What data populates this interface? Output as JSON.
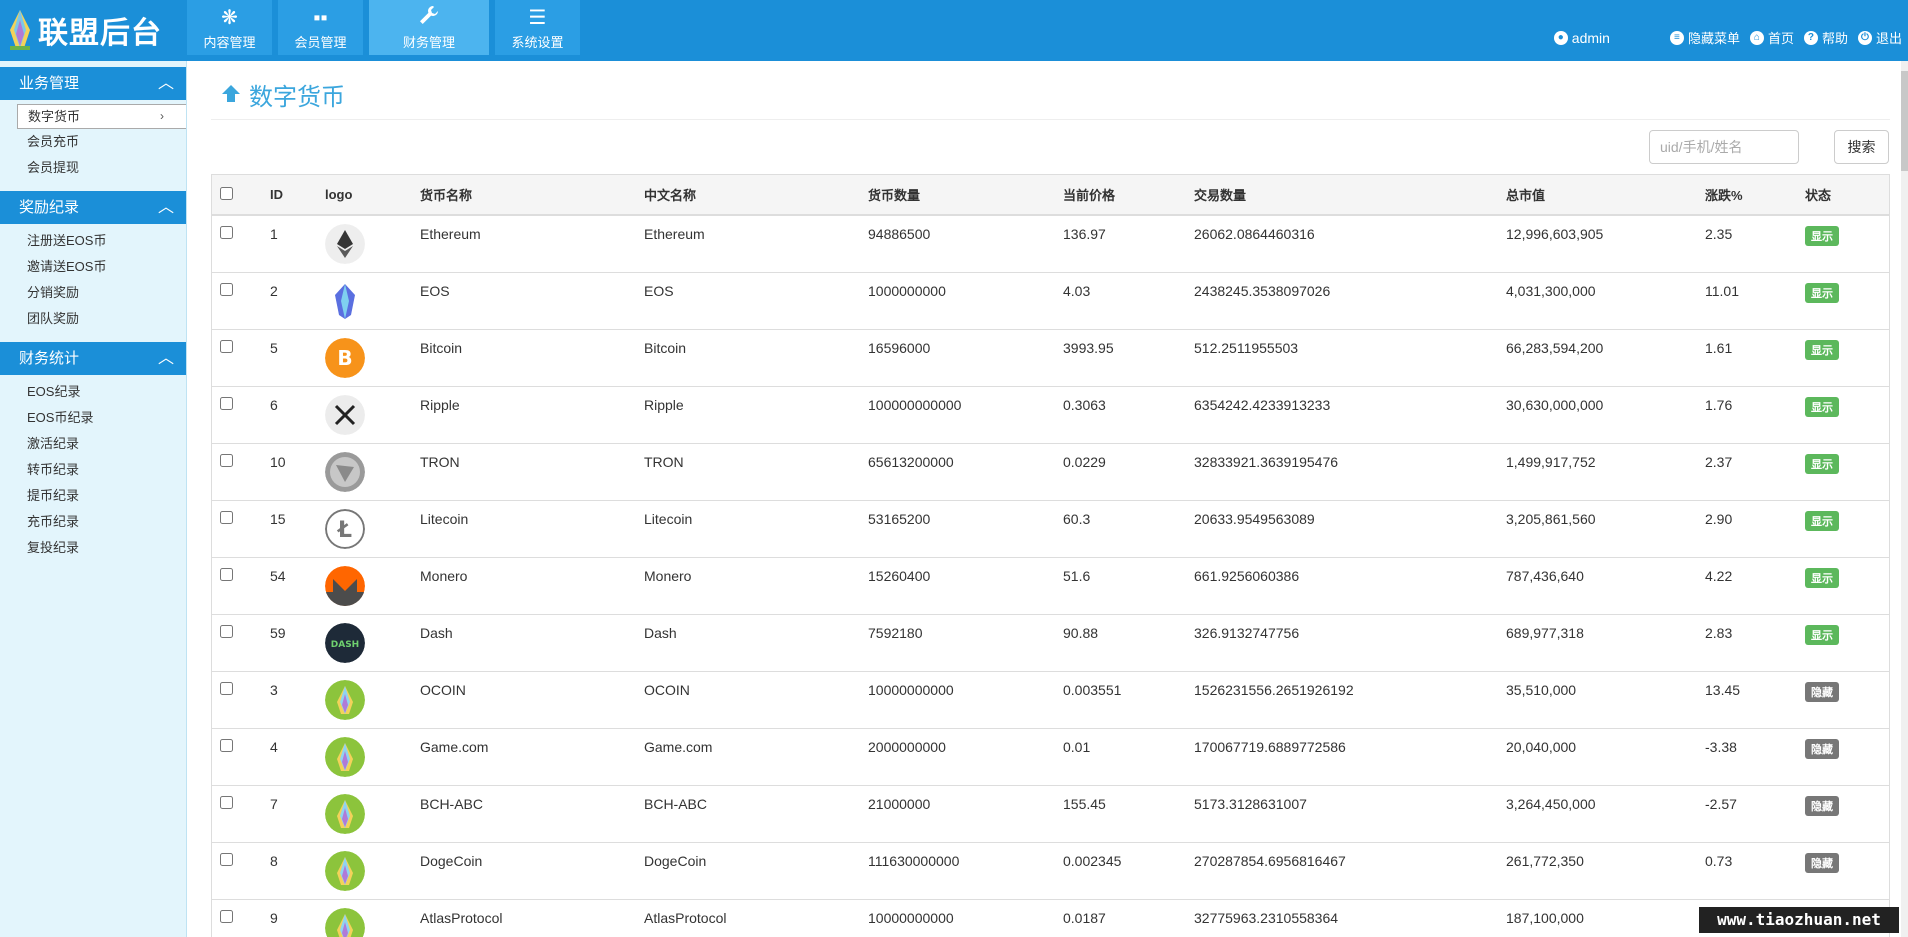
{
  "header": {
    "brand": "联盟后台",
    "nav": [
      {
        "label": "内容管理",
        "icon": "snowflake-icon"
      },
      {
        "label": "会员管理",
        "icon": "grid-icon"
      },
      {
        "label": "财务管理",
        "icon": "wrench-icon"
      },
      {
        "label": "系统设置",
        "icon": "list-icon"
      }
    ],
    "active_nav": "财务管理",
    "user": "admin",
    "links": [
      "隐藏菜单",
      "首页",
      "帮助",
      "退出"
    ]
  },
  "sidebar": {
    "sections": [
      {
        "title": "业务管理",
        "items": [
          "数字货币",
          "会员充币",
          "会员提现"
        ]
      },
      {
        "title": "奖励纪录",
        "items": [
          "注册送EOS币",
          "邀请送EOS币",
          "分销奖励",
          "团队奖励"
        ]
      },
      {
        "title": "财务统计",
        "items": [
          "EOS纪录",
          "EOS币纪录",
          "激活纪录",
          "转币纪录",
          "提币纪录",
          "充币纪录",
          "复投纪录"
        ]
      }
    ],
    "active_item": "数字货币"
  },
  "main": {
    "title": "数字货币",
    "search_placeholder": "uid/手机/姓名",
    "search_button": "搜索"
  },
  "table": {
    "columns": [
      "ID",
      "logo",
      "货币名称",
      "中文名称",
      "货币数量",
      "当前价格",
      "交易数量",
      "总市值",
      "涨跌%",
      "状态"
    ],
    "rows": [
      {
        "id": "1",
        "logo": "ethereum-logo-icon",
        "name": "Ethereum",
        "cn_name": "Ethereum",
        "supply": "94886500",
        "price": "136.97",
        "volume": "26062.0864460316",
        "market_cap": "12,996,603,905",
        "change": "2.35",
        "status": "显示",
        "shown": true
      },
      {
        "id": "2",
        "logo": "eos-logo-icon",
        "name": "EOS",
        "cn_name": "EOS",
        "supply": "1000000000",
        "price": "4.03",
        "volume": "2438245.3538097026",
        "market_cap": "4,031,300,000",
        "change": "11.01",
        "status": "显示",
        "shown": true
      },
      {
        "id": "5",
        "logo": "bitcoin-logo-icon",
        "name": "Bitcoin",
        "cn_name": "Bitcoin",
        "supply": "16596000",
        "price": "3993.95",
        "volume": "512.2511955503",
        "market_cap": "66,283,594,200",
        "change": "1.61",
        "status": "显示",
        "shown": true
      },
      {
        "id": "6",
        "logo": "ripple-logo-icon",
        "name": "Ripple",
        "cn_name": "Ripple",
        "supply": "100000000000",
        "price": "0.3063",
        "volume": "6354242.4233913233",
        "market_cap": "30,630,000,000",
        "change": "1.76",
        "status": "显示",
        "shown": true
      },
      {
        "id": "10",
        "logo": "tron-logo-icon",
        "name": "TRON",
        "cn_name": "TRON",
        "supply": "65613200000",
        "price": "0.0229",
        "volume": "32833921.3639195476",
        "market_cap": "1,499,917,752",
        "change": "2.37",
        "status": "显示",
        "shown": true
      },
      {
        "id": "15",
        "logo": "litecoin-logo-icon",
        "name": "Litecoin",
        "cn_name": "Litecoin",
        "supply": "53165200",
        "price": "60.3",
        "volume": "20633.9549563089",
        "market_cap": "3,205,861,560",
        "change": "2.90",
        "status": "显示",
        "shown": true
      },
      {
        "id": "54",
        "logo": "monero-logo-icon",
        "name": "Monero",
        "cn_name": "Monero",
        "supply": "15260400",
        "price": "51.6",
        "volume": "661.9256060386",
        "market_cap": "787,436,640",
        "change": "4.22",
        "status": "显示",
        "shown": true
      },
      {
        "id": "59",
        "logo": "dash-logo-icon",
        "name": "Dash",
        "cn_name": "Dash",
        "supply": "7592180",
        "price": "90.88",
        "volume": "326.9132747756",
        "market_cap": "689,977,318",
        "change": "2.83",
        "status": "显示",
        "shown": true
      },
      {
        "id": "3",
        "logo": "default-coin-icon",
        "name": "OCOIN",
        "cn_name": "OCOIN",
        "supply": "10000000000",
        "price": "0.003551",
        "volume": "1526231556.2651926192",
        "market_cap": "35,510,000",
        "change": "13.45",
        "status": "隐藏",
        "shown": false
      },
      {
        "id": "4",
        "logo": "default-coin-icon",
        "name": "Game.com",
        "cn_name": "Game.com",
        "supply": "2000000000",
        "price": "0.01",
        "volume": "170067719.6889772586",
        "market_cap": "20,040,000",
        "change": "-3.38",
        "status": "隐藏",
        "shown": false
      },
      {
        "id": "7",
        "logo": "default-coin-icon",
        "name": "BCH-ABC",
        "cn_name": "BCH-ABC",
        "supply": "21000000",
        "price": "155.45",
        "volume": "5173.3128631007",
        "market_cap": "3,264,450,000",
        "change": "-2.57",
        "status": "隐藏",
        "shown": false
      },
      {
        "id": "8",
        "logo": "default-coin-icon",
        "name": "DogeCoin",
        "cn_name": "DogeCoin",
        "supply": "111630000000",
        "price": "0.002345",
        "volume": "270287854.6956816467",
        "market_cap": "261,772,350",
        "change": "0.73",
        "status": "隐藏",
        "shown": false
      },
      {
        "id": "9",
        "logo": "default-coin-icon",
        "name": "AtlasProtocol",
        "cn_name": "AtlasProtocol",
        "supply": "10000000000",
        "price": "0.0187",
        "volume": "32775963.2310558364",
        "market_cap": "187,100,000",
        "change": "",
        "status": "",
        "shown": false
      }
    ]
  },
  "watermark": "www.tiaozhuan.net",
  "colors": {
    "header": "#1b8fd8",
    "accent": "#3ba6dd",
    "shown": "#5cb85c",
    "hidden": "#777777"
  }
}
